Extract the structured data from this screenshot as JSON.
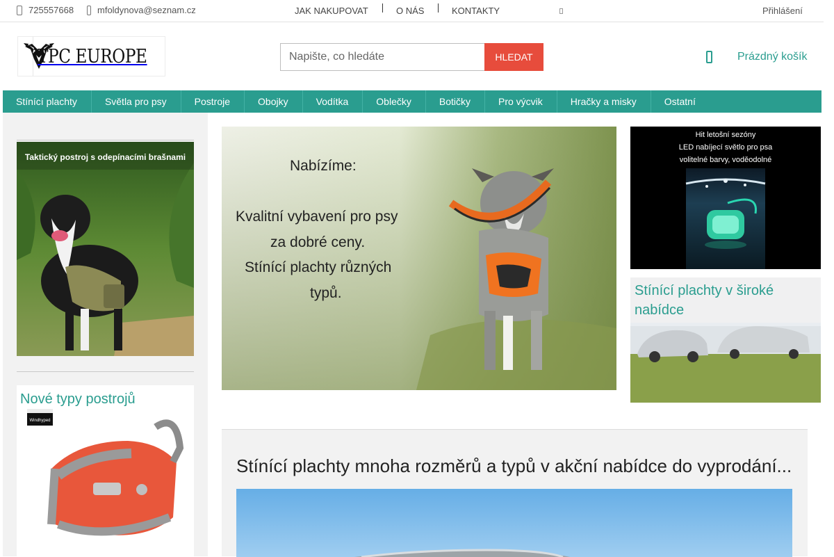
{
  "topbar": {
    "phone": "725557668",
    "email": "mfoldynova@seznam.cz",
    "links": [
      "JAK NAKUPOVAT",
      "O NÁS",
      "KONTAKTY"
    ],
    "login": "Přihlášení"
  },
  "header": {
    "logo_text": "TPC EUROPE",
    "search_placeholder": "Napište, co hledáte",
    "search_button": "HLEDAT",
    "cart_label": "Prázdný košík"
  },
  "nav": {
    "items": [
      "Stínící plachty",
      "Světla pro psy",
      "Postroje",
      "Obojky",
      "Vodítka",
      "Oblečky",
      "Botičky",
      "Pro výcvik",
      "Hračky a misky",
      "Ostatní"
    ]
  },
  "sidebar": {
    "banner1_caption": "Taktický postroj s odepínacími brašnami",
    "banner2_title": "Nové typy postrojů",
    "banner2_brand": "Windhyped"
  },
  "hero": {
    "line1": "Nabízíme:",
    "line2": "Kvalitní vybavení pro psy",
    "line3": "za dobré ceny.",
    "line4": "Stínící plachty různých",
    "line5": "typů."
  },
  "right_banners": {
    "b1_line1": "Hit letošní sezóny",
    "b1_line2": "LED nabíjecí světlo pro psa",
    "b1_line3": "volitelné barvy, voděodolné",
    "b2_title": "Stínící plachty v široké nabídce"
  },
  "content": {
    "heading": "Stínící plachty mnoha rozměrů a typů v akční nabídce do vyprodání..."
  },
  "colors": {
    "accent": "#2a9d8f",
    "search_button": "#e74c3c",
    "panel": "#f2f2f2"
  }
}
